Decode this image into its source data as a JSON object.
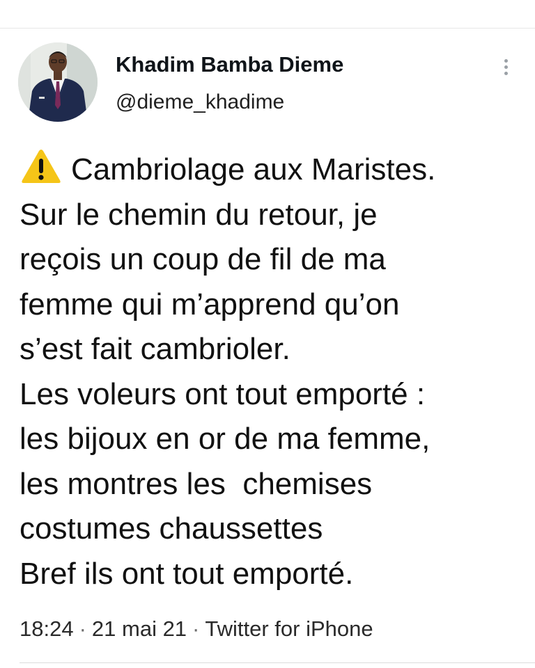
{
  "author": {
    "display_name": "Khadim Bamba Dieme",
    "handle": "@dieme_khadime"
  },
  "tweet": {
    "warning_icon": "warning-sign-icon",
    "lines": [
      "Cambriolage aux Maristes.",
      "Sur le chemin du retour, je",
      "reçois un coup de fil de ma",
      "femme qui m’apprend qu’on",
      "s’est fait cambrioler.",
      "Les voleurs ont tout emporté :",
      "les bijoux en or de ma femme,",
      "les montres les  chemises",
      "costumes chaussettes",
      "Bref ils ont tout emporté."
    ]
  },
  "meta": {
    "time": "18:24",
    "separator": "·",
    "date": "21 mai 21",
    "source": "Twitter for iPhone"
  },
  "colors": {
    "warning": "#f5c518",
    "text": "#111111",
    "muted": "#6b6b6b"
  }
}
